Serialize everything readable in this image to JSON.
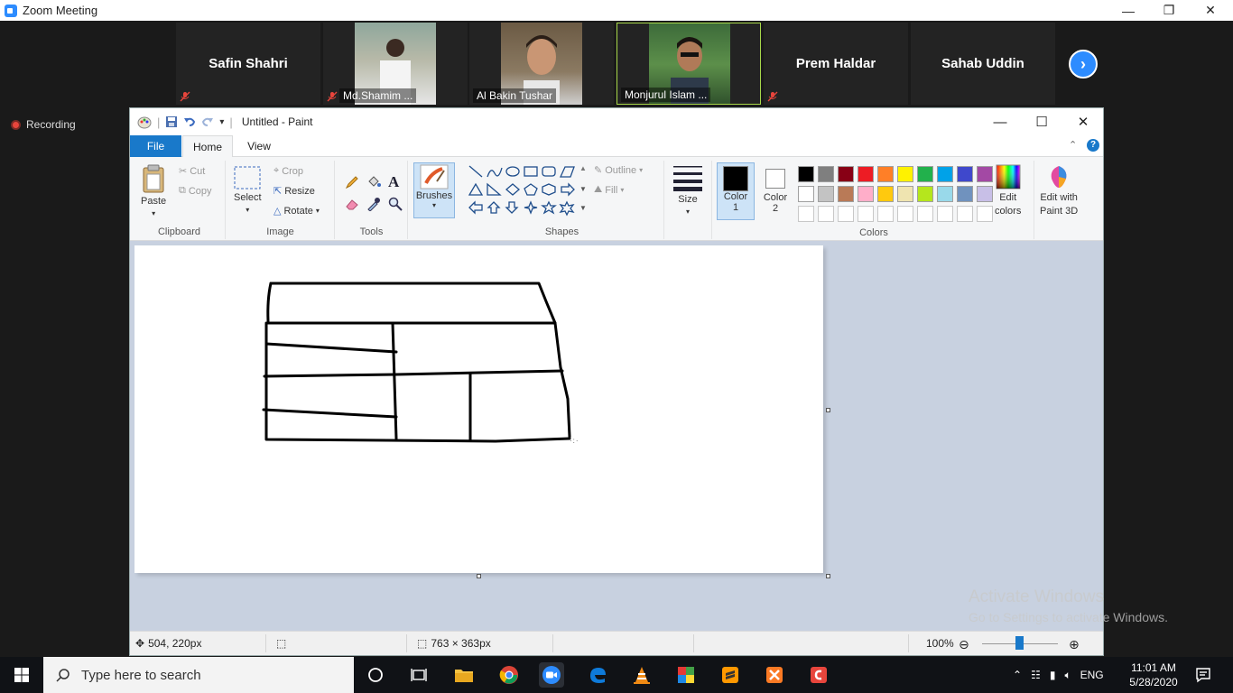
{
  "zoom": {
    "title": "Zoom Meeting",
    "recording_label": "Recording",
    "participants": [
      {
        "name": "Safin Shahri",
        "muted": true
      },
      {
        "name": "Md.Shamim ...",
        "muted": true
      },
      {
        "name": "Al Bakin Tushar",
        "muted": false
      },
      {
        "name": "Monjurul Islam ...",
        "muted": false
      },
      {
        "name": "Prem Haldar",
        "muted": true
      },
      {
        "name": "Sahab Uddin",
        "muted": false
      }
    ]
  },
  "paint": {
    "title": "Untitled - Paint",
    "tabs": {
      "file": "File",
      "home": "Home",
      "view": "View"
    },
    "clipboard": {
      "paste": "Paste",
      "cut": "Cut",
      "copy": "Copy",
      "label": "Clipboard"
    },
    "image": {
      "select": "Select",
      "crop": "Crop",
      "resize": "Resize",
      "rotate": "Rotate",
      "label": "Image"
    },
    "tools": {
      "label": "Tools"
    },
    "brushes": {
      "label": "Brushes"
    },
    "shapes": {
      "outline": "Outline",
      "fill": "Fill",
      "label": "Shapes"
    },
    "size": {
      "label": "Size"
    },
    "colors": {
      "color1": "Color",
      "color1_num": "1",
      "color2": "Color",
      "color2_num": "2",
      "edit_colors_1": "Edit",
      "edit_colors_2": "colors",
      "edit3d_1": "Edit with",
      "edit3d_2": "Paint 3D",
      "label": "Colors",
      "palette_row1": [
        "#000000",
        "#7f7f7f",
        "#880015",
        "#ed1c24",
        "#ff7f27",
        "#fff200",
        "#22b14c",
        "#00a2e8",
        "#3f48cc",
        "#a349a4"
      ],
      "palette_row2": [
        "#ffffff",
        "#c3c3c3",
        "#b97a57",
        "#ffaec9",
        "#ffc90e",
        "#efe4b0",
        "#b5e61d",
        "#99d9ea",
        "#7092be",
        "#c8bfe7"
      ]
    },
    "status": {
      "cursor": "504, 220px",
      "dimensions": "763 × 363px",
      "zoom": "100%"
    }
  },
  "watermark": {
    "line1": "Activate Windows",
    "line2": "Go to Settings to activate Windows."
  },
  "taskbar": {
    "search_placeholder": "Type here to search",
    "language": "ENG",
    "time": "11:01 AM",
    "date": "5/28/2020"
  }
}
